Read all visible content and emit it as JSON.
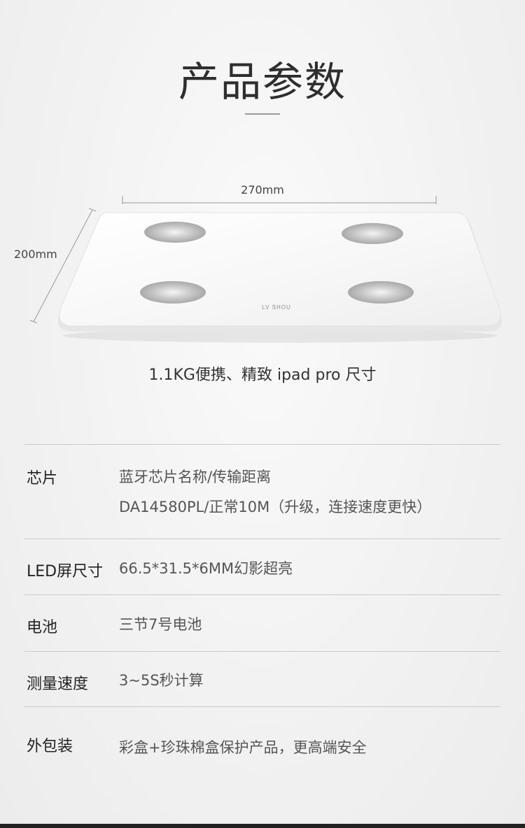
{
  "header": {
    "title": "产品参数"
  },
  "product": {
    "width_label": "270mm",
    "height_label": "200mm",
    "brand_mark": "LV SHOU",
    "caption": "1.1KG便携、精致 ipad pro 尺寸"
  },
  "specs": [
    {
      "label": "芯片",
      "lines": [
        "蓝牙芯片名称/传输距离",
        "DA14580PL/正常10M（升级，连接速度更快）"
      ]
    },
    {
      "label": "LED屏尺寸",
      "lines": [
        "66.5*31.5*6MM幻影超亮"
      ]
    },
    {
      "label": "电池",
      "lines": [
        "三节7号电池"
      ]
    },
    {
      "label": "测量速度",
      "lines": [
        " 3~5S秒计算"
      ]
    },
    {
      "label": "外包装",
      "lines": [
        "彩盒+珍珠棉盒保护产品，更高端安全"
      ]
    }
  ],
  "colors": {
    "background": "#f1f1f1",
    "text": "#333333",
    "divider": "#c9c9c9"
  }
}
